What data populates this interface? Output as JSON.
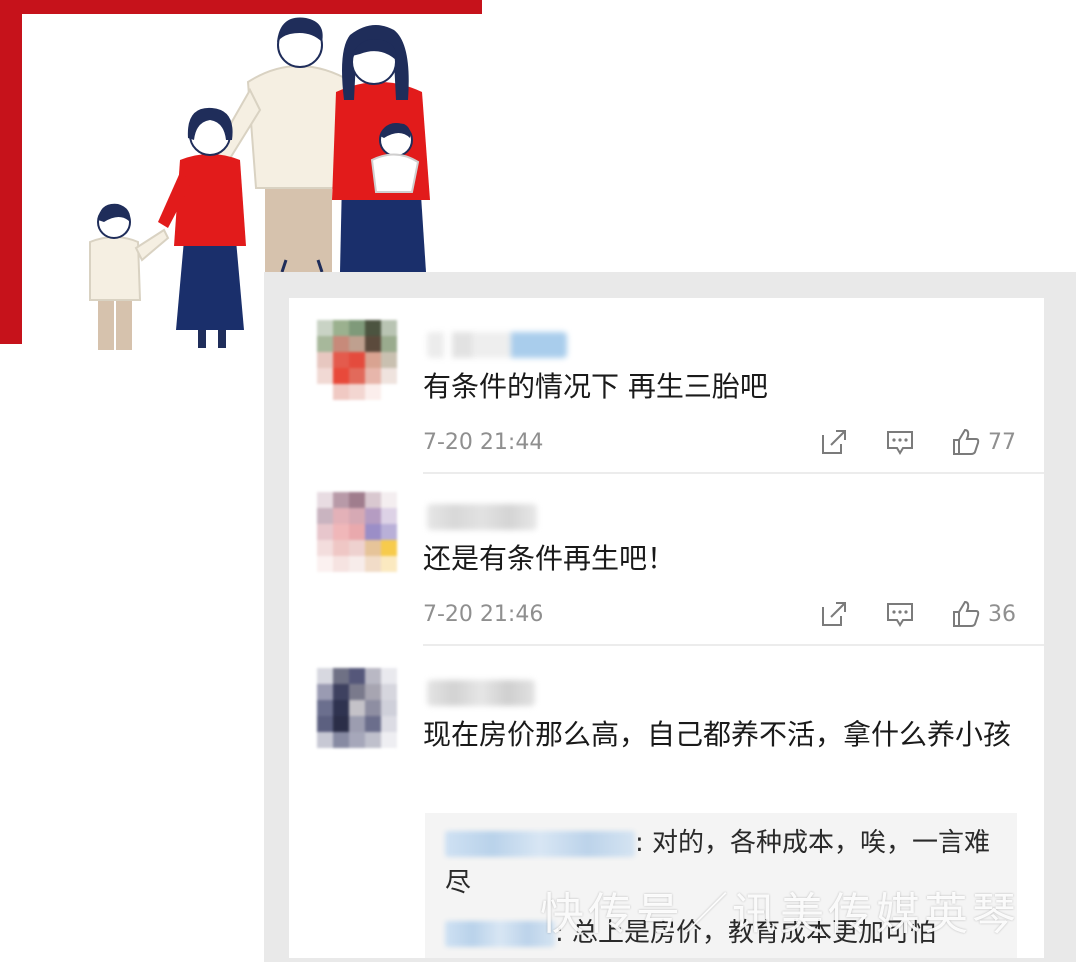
{
  "comments": [
    {
      "text": "有条件的情况下 再生三胎吧",
      "time": "7-20 21:44",
      "likes": "77",
      "icons": [
        "share-icon",
        "reply-icon",
        "like-icon"
      ]
    },
    {
      "text": "还是有条件再生吧！",
      "time": "7-20 21:46",
      "likes": "36",
      "icons": [
        "share-icon",
        "reply-icon",
        "like-icon"
      ]
    },
    {
      "text": "现在房价那么高，自己都养不活，拿什么养小孩"
    }
  ],
  "replies": [
    {
      "text": ": 对的，各种成本，唉，一言难尽"
    },
    {
      "text": ": 总上是房价，教育成本更加可怕"
    }
  ],
  "watermark": "快传号／讯美传媒英琴",
  "colors": {
    "frame_red": "#c6121b",
    "panel_bg": "#e9e9e9",
    "meta_gray": "#8f8f8f"
  }
}
